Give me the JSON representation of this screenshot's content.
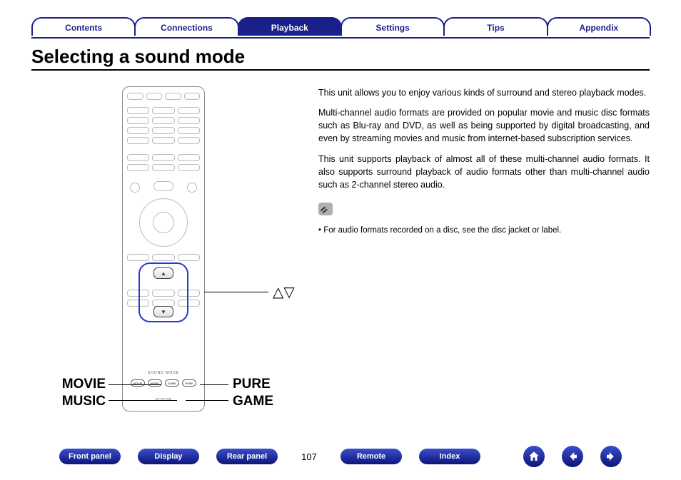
{
  "tabs": {
    "contents": "Contents",
    "connections": "Connections",
    "playback": "Playback",
    "settings": "Settings",
    "tips": "Tips",
    "appendix": "Appendix",
    "active": "playback"
  },
  "heading": "Selecting a sound mode",
  "remote": {
    "sound_mode_heading": "SOUND MODE",
    "buttons": {
      "movie": "MOVIE",
      "music": "MUSIC",
      "game": "GAME",
      "pure": "PURE"
    },
    "model": "RC921SR"
  },
  "callouts": {
    "updown": "△▽",
    "left": {
      "line1": "MOVIE",
      "line2": "MUSIC"
    },
    "right": {
      "line1": "PURE",
      "line2": "GAME"
    }
  },
  "body": {
    "p1": "This unit allows you to enjoy various kinds of surround and stereo playback modes.",
    "p2": "Multi-channel audio formats are provided on popular movie and music disc formats such as Blu-ray and DVD, as well as being supported by digital broadcasting, and even by streaming movies and music from internet-based subscription services.",
    "p3": "This unit supports playback of almost all of these multi-channel audio formats. It also supports surround playback of audio formats other than multi-channel audio such as 2-channel stereo audio.",
    "note": "For audio formats recorded on a disc, see the disc jacket or label."
  },
  "bottom": {
    "front_panel": "Front panel",
    "display": "Display",
    "rear_panel": "Rear panel",
    "remote": "Remote",
    "index": "Index",
    "page": "107"
  }
}
